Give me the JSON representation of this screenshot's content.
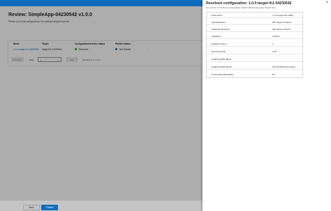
{
  "review": {
    "title": "Review: SimpleApp-04230542 v1.0.0",
    "subtitle": "Review your final configurations for individual targets selected"
  },
  "table": {
    "columns": [
      "Name",
      "Target",
      "Configuration/resolve status",
      "Publish status"
    ],
    "rows": [
      {
        "name": "1.0.0-target-lh1-04230542",
        "target": "target-lh1-04230542",
        "config_status": "Resolved",
        "publish_status": "Not Started",
        "more": "..."
      }
    ]
  },
  "pager": {
    "previous_label": "Previous",
    "page_label": "Page",
    "page_value": "1",
    "next_label": "Next",
    "showing_text": "Showing 1 to 1 of 1"
  },
  "footer": {
    "back_label": "Back",
    "publish_label": "Publish"
  },
  "panel": {
    "title": "Resolved configuration: 1.0.0-target-lh1-04230542",
    "subtitle": "See all the CF defined configuration details and inherent app details here",
    "close_glyph": "×",
    "properties": [
      {
        "key": "Parameters",
        "value": "v1.0.0-target-lh1-0482"
      },
      {
        "key": "AgentEndpoint",
        "value": "http://agent.endpoint"
      },
      {
        "key": "ApplicationEndpoint",
        "value": "http://app1.endpoint"
      },
      {
        "key": "AppName",
        "value": "Vodcast"
      },
      {
        "key": "EnableLocalLog",
        "value": "1"
      },
      {
        "key": "ErrorThreshold",
        "value": "0.35"
      },
      {
        "key": "HealthCheckEnabled",
        "value": ""
      },
      {
        "key": "HealthCheckEndpoint",
        "value": "http://healthcheck.endpo..."
      },
      {
        "key": "TemperatureRangeMax",
        "value": "50"
      }
    ]
  },
  "colors": {
    "brand": "#0f6cbd",
    "resolved": "#13a10e",
    "not_started": "#0f6cbd"
  }
}
